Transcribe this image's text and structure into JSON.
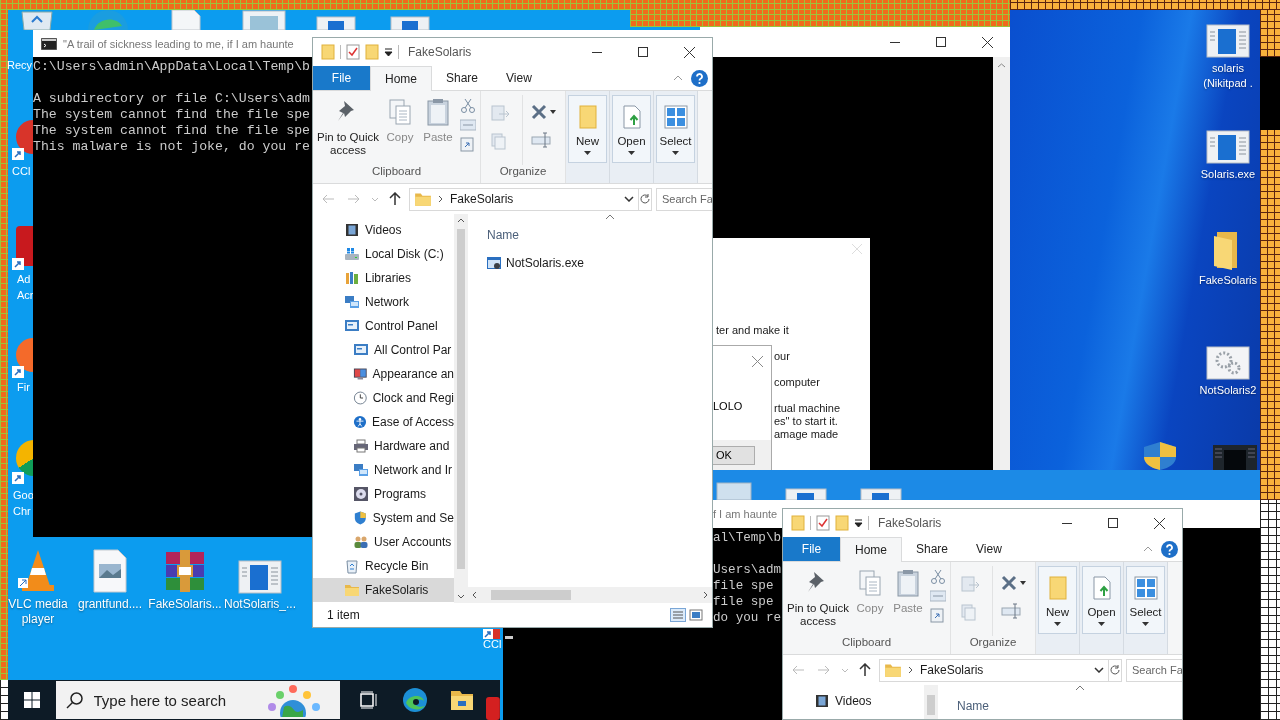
{
  "desktop": {
    "edge_labels": [
      {
        "label": "Recy"
      },
      {
        "label": "CCl"
      },
      {
        "label": "Ad"
      },
      {
        "label": "Acr"
      },
      {
        "label": "Fir"
      },
      {
        "label": "Goo"
      },
      {
        "label": "Chr"
      },
      {
        "label": "CCl"
      }
    ],
    "right_icons": [
      {
        "kind": "app",
        "label": "solaris (Nikitpad ."
      },
      {
        "kind": "app",
        "label": "Solaris.exe"
      },
      {
        "kind": "folder",
        "label": "FakeSolaris"
      },
      {
        "kind": "gear",
        "label": "NotSolaris2"
      }
    ],
    "bottom_icons": [
      {
        "kind": "cone",
        "label": "VLC media player"
      },
      {
        "kind": "image",
        "label": "grantfund...."
      },
      {
        "kind": "archive",
        "label": "FakeSolaris..."
      },
      {
        "kind": "app",
        "label": "NotSolaris_..."
      }
    ]
  },
  "console_window": {
    "title": "\"A trail of sickness leading to me, if I am haunte",
    "path": "C:\\Users\\admin\\AppData\\Local\\Temp\\b",
    "lines": [
      "A subdirectory or file C:\\Users\\adm",
      "The system cannot find the file spe",
      "The system cannot find the file spe",
      "This malware is not joke, do you re"
    ]
  },
  "message_box": {
    "lines": [
      "ter and make it",
      "our",
      "computer",
      "rtual machine",
      "es\" to start it.",
      "amage made"
    ]
  },
  "small_dialog": {
    "text": "LOLO",
    "button": "OK"
  },
  "console_copy": {
    "title": "f I am haunte",
    "path": "al\\Temp\\b",
    "lines": [
      "Users\\adm",
      "file spe",
      "file spe",
      "do you re"
    ]
  },
  "explorers": [
    {
      "title": "FakeSolaris",
      "tabs": [
        {
          "label": "File",
          "kind": "menu",
          "selected": false
        },
        {
          "label": "Home",
          "kind": "tab",
          "selected": true
        },
        {
          "label": "Share",
          "kind": "tab",
          "selected": false
        },
        {
          "label": "View",
          "kind": "tab",
          "selected": false
        }
      ],
      "ribbon": {
        "large_buttons": [
          {
            "label": "Pin to Quick access",
            "kind": "pin",
            "disabled": false
          },
          {
            "label": "Copy",
            "kind": "copy",
            "disabled": true
          },
          {
            "label": "Paste",
            "kind": "paste",
            "disabled": true
          }
        ],
        "groups": [
          "Clipboard",
          "Organize"
        ],
        "split_buttons": [
          {
            "label": "New",
            "kind": "new"
          },
          {
            "label": "Open",
            "kind": "open"
          },
          {
            "label": "Select",
            "kind": "select"
          }
        ]
      },
      "address": {
        "path": "FakeSolaris",
        "search_placeholder": "Search Fa"
      },
      "nav": [
        {
          "label": "Videos",
          "kind": "video",
          "selected": false
        },
        {
          "label": "Local Disk (C:)",
          "kind": "drive",
          "selected": false
        },
        {
          "label": "Libraries",
          "kind": "library",
          "selected": false
        },
        {
          "label": "Network",
          "kind": "network",
          "selected": false
        },
        {
          "label": "Control Panel",
          "kind": "panel",
          "selected": false,
          "children": [
            {
              "label": "All Control Par",
              "kind": "panel",
              "selected": false
            },
            {
              "label": "Appearance an",
              "kind": "display",
              "selected": false
            },
            {
              "label": "Clock and Regi",
              "kind": "clock",
              "selected": false
            },
            {
              "label": "Ease of Access",
              "kind": "access",
              "selected": false
            },
            {
              "label": "Hardware and",
              "kind": "printer",
              "selected": false
            },
            {
              "label": "Network and Ir",
              "kind": "network",
              "selected": false
            },
            {
              "label": "Programs",
              "kind": "disc",
              "selected": false
            },
            {
              "label": "System and Se",
              "kind": "shield",
              "selected": false
            },
            {
              "label": "User Accounts",
              "kind": "users",
              "selected": false
            }
          ]
        },
        {
          "label": "Recycle Bin",
          "kind": "recycle",
          "selected": false
        },
        {
          "label": "FakeSolaris",
          "kind": "folder",
          "selected": true
        }
      ],
      "column": "Name",
      "files": [
        {
          "name": "NotSolaris.exe"
        }
      ],
      "status": "1 item"
    },
    {
      "title": "FakeSolaris",
      "tabs": [
        {
          "label": "File",
          "kind": "menu",
          "selected": false
        },
        {
          "label": "Home",
          "kind": "tab",
          "selected": true
        },
        {
          "label": "Share",
          "kind": "tab",
          "selected": false
        },
        {
          "label": "View",
          "kind": "tab",
          "selected": false
        }
      ],
      "ribbon": {
        "large_buttons": [
          {
            "label": "Pin to Quick access",
            "kind": "pin",
            "disabled": false
          },
          {
            "label": "Copy",
            "kind": "copy",
            "disabled": true
          },
          {
            "label": "Paste",
            "kind": "paste",
            "disabled": true
          }
        ],
        "groups": [
          "Clipboard",
          "Organize"
        ],
        "split_buttons": [
          {
            "label": "New",
            "kind": "new"
          },
          {
            "label": "Open",
            "kind": "open"
          },
          {
            "label": "Select",
            "kind": "select"
          }
        ]
      },
      "address": {
        "path": "FakeSolaris",
        "search_placeholder": "Search Fa"
      },
      "nav": [
        {
          "label": "Videos",
          "kind": "video",
          "selected": false
        }
      ],
      "column": "Name"
    }
  ],
  "taskbar": {
    "search_placeholder": "Type here to search"
  }
}
